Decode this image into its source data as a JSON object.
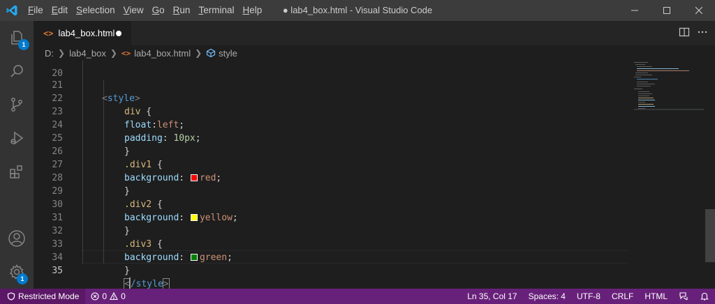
{
  "titlebar": {
    "app_icon": "vscode-logo-icon",
    "menu": [
      {
        "pre": "",
        "u": "F",
        "post": "ile"
      },
      {
        "pre": "",
        "u": "E",
        "post": "dit"
      },
      {
        "pre": "",
        "u": "S",
        "post": "election"
      },
      {
        "pre": "",
        "u": "V",
        "post": "iew"
      },
      {
        "pre": "",
        "u": "G",
        "post": "o"
      },
      {
        "pre": "",
        "u": "R",
        "post": "un"
      },
      {
        "pre": "",
        "u": "T",
        "post": "erminal"
      },
      {
        "pre": "",
        "u": "H",
        "post": "elp"
      }
    ],
    "title": "● lab4_box.html - Visual Studio Code",
    "controls": [
      "minimize-icon",
      "maximize-icon",
      "close-icon"
    ]
  },
  "activitybar": {
    "items": [
      {
        "icon": "explorer-icon",
        "badge": "1"
      },
      {
        "icon": "search-icon"
      },
      {
        "icon": "source-control-icon"
      },
      {
        "icon": "run-debug-icon"
      },
      {
        "icon": "extensions-icon"
      }
    ],
    "bottom": [
      {
        "icon": "accounts-icon"
      },
      {
        "icon": "manage-gear-icon",
        "badge": "1"
      }
    ]
  },
  "tab": {
    "icon_text": "<>",
    "label": "lab4_box.html",
    "dirty": true
  },
  "editor_actions": [
    "split-editor-icon",
    "more-actions-icon"
  ],
  "breadcrumb": {
    "drive": "D:",
    "folder": "lab4_box",
    "file": "lab4_box.html",
    "symbol": "style"
  },
  "editor": {
    "partial_top_line": "20",
    "lines": [
      {
        "n": "21"
      },
      {
        "n": "22"
      },
      {
        "n": "23"
      },
      {
        "n": "24"
      },
      {
        "n": "25"
      },
      {
        "n": "26"
      },
      {
        "n": "27"
      },
      {
        "n": "28"
      },
      {
        "n": "29"
      },
      {
        "n": "30"
      },
      {
        "n": "31"
      },
      {
        "n": "32"
      },
      {
        "n": "33"
      },
      {
        "n": "34"
      },
      {
        "n": "35"
      }
    ],
    "tokens": {
      "l21_lt": "<",
      "l21_tag": "style",
      "l21_gt": ">",
      "l22_sel": "div",
      "l22_brace": " {",
      "l23_prop": "float",
      "l23_colon": ":",
      "l23_val": "left",
      "l23_semi": ";",
      "l24_prop": "padding",
      "l24_colon": ": ",
      "l24_val": "10px",
      "l24_semi": ";",
      "l25_brace": "}",
      "l26_sel": ".div1",
      "l26_brace": " {",
      "l27_prop": "background",
      "l27_colon": ": ",
      "l27_val": "red",
      "l27_semi": ";",
      "l28_brace": "}",
      "l29_sel": ".div2",
      "l29_brace": " {",
      "l30_prop": "background",
      "l30_colon": ": ",
      "l30_val": "yellow",
      "l30_semi": ";",
      "l31_brace": "}",
      "l32_sel": ".div3",
      "l32_brace": " {",
      "l33_prop": "background",
      "l33_colon": ": ",
      "l33_val": "green",
      "l33_semi": ";",
      "l34_brace": "}",
      "l35_lt": "<",
      "l35_tag": "/style",
      "l35_gt": ">"
    },
    "swatches": {
      "red": "#ff0000",
      "yellow": "#ffff00",
      "green": "#008000"
    },
    "active_line": "35"
  },
  "statusbar": {
    "restricted_mode": "Restricted Mode",
    "errors": "0",
    "warnings": "0",
    "position": "Ln 35, Col 17",
    "spaces": "Spaces: 4",
    "encoding": "UTF-8",
    "eol": "CRLF",
    "language": "HTML",
    "background": "#68217a"
  }
}
